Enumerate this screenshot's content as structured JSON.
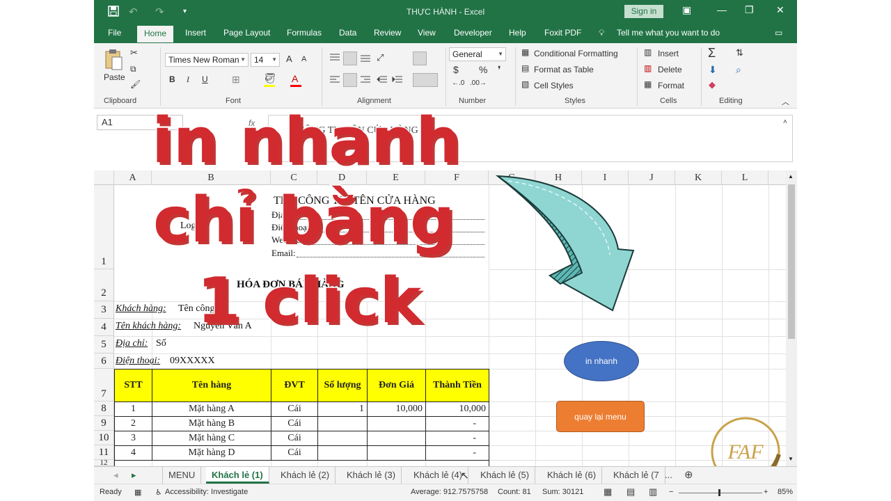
{
  "title_bar": {
    "title": "THỰC HÀNH  -  Excel",
    "sign_in": "Sign in"
  },
  "menu_tabs": [
    "File",
    "Home",
    "Insert",
    "Page Layout",
    "Formulas",
    "Data",
    "Review",
    "View",
    "Developer",
    "Help",
    "Foxit PDF"
  ],
  "tell_me": "Tell me what you want to do",
  "ribbon": {
    "paste": "Paste",
    "font_name": "Times New Roman",
    "font_size": "14",
    "number_format": "General",
    "conditional_formatting": "Conditional Formatting",
    "format_as_table": "Format as Table",
    "cell_styles": "Cell Styles",
    "insert": "Insert",
    "delete": "Delete",
    "format": "Format",
    "groups": {
      "clipboard": "Clipboard",
      "font": "Font",
      "alignment": "Alignment",
      "number": "Number",
      "styles": "Styles",
      "cells": "Cells",
      "editing": "Editing"
    },
    "bold": "B",
    "italic": "I",
    "underline": "U",
    "currency": "$",
    "percent": "%",
    "comma": "❜",
    "inc_font": "A",
    "dec_font": "A"
  },
  "name_box": "A1",
  "formula_value": "T  CÔNG TY/ TÊN CỬA HÀNG",
  "columns": [
    "A",
    "B",
    "C",
    "D",
    "E",
    "F",
    "G",
    "H",
    "I",
    "J",
    "K",
    "L"
  ],
  "rows": [
    "1",
    "2",
    "3",
    "4",
    "5",
    "6",
    "7",
    "8",
    "9",
    "10",
    "11",
    "12"
  ],
  "invoice": {
    "logo": "Logo",
    "company": "TÊN CÔNG TY/ TÊN CỬA HÀNG",
    "address_label": "Địa chỉ:",
    "phone_label": "Điện thoại:",
    "website_label": "Website:",
    "email_label": "Email:",
    "title": "HÓA ĐƠN BÁN HÀNG",
    "customer_label": "Khách hàng:",
    "customer_value": "Tên công ty",
    "customer_name_label": "Tên khách hàng:",
    "customer_name_value": "Nguyễn Văn A",
    "address2_label": "Địa chỉ:",
    "address2_value": "Số",
    "phone2_label": "Điện thoại:",
    "phone2_value": "09XXXXX",
    "table_headers": [
      "STT",
      "Tên hàng",
      "ĐVT",
      "Số lượng",
      "Đơn Giá",
      "Thành Tiền"
    ],
    "table_rows": [
      {
        "stt": "1",
        "name": "Mặt hàng A",
        "unit": "Cái",
        "qty": "1",
        "price": "10,000",
        "total": "10,000"
      },
      {
        "stt": "2",
        "name": "Mặt hàng B",
        "unit": "Cái",
        "qty": "",
        "price": "",
        "total": "-"
      },
      {
        "stt": "3",
        "name": "Mặt hàng C",
        "unit": "Cái",
        "qty": "",
        "price": "",
        "total": "-"
      },
      {
        "stt": "4",
        "name": "Mặt hàng D",
        "unit": "Cái",
        "qty": "",
        "price": "",
        "total": "-"
      }
    ]
  },
  "shapes": {
    "print_quick": "in nhanh",
    "back_menu": "quay lại menu"
  },
  "overlay": {
    "line1": "in nhanh",
    "line2": "chỉ bằng",
    "line3": "1 click"
  },
  "sheet_tabs": [
    "MENU",
    "Khách lẻ (1)",
    "Khách lẻ (2)",
    "Khách lẻ (3)",
    "Khách lẻ (4)",
    "Khách lẻ (5)",
    "Khách lẻ (6)",
    "Khách lẻ (7",
    "..."
  ],
  "status": {
    "ready": "Ready",
    "accessibility": "Accessibility: Investigate",
    "average": "Average: 912.7575758",
    "count": "Count: 81",
    "sum": "Sum: 30121",
    "zoom": "85%"
  },
  "colors": {
    "excel_green": "#217346",
    "header_yellow": "#ffff00",
    "overlay_red": "#d12a2f",
    "arrow_teal": "#7fd0cc",
    "oval_blue": "#4472c4",
    "button_orange": "#ed7d31"
  }
}
